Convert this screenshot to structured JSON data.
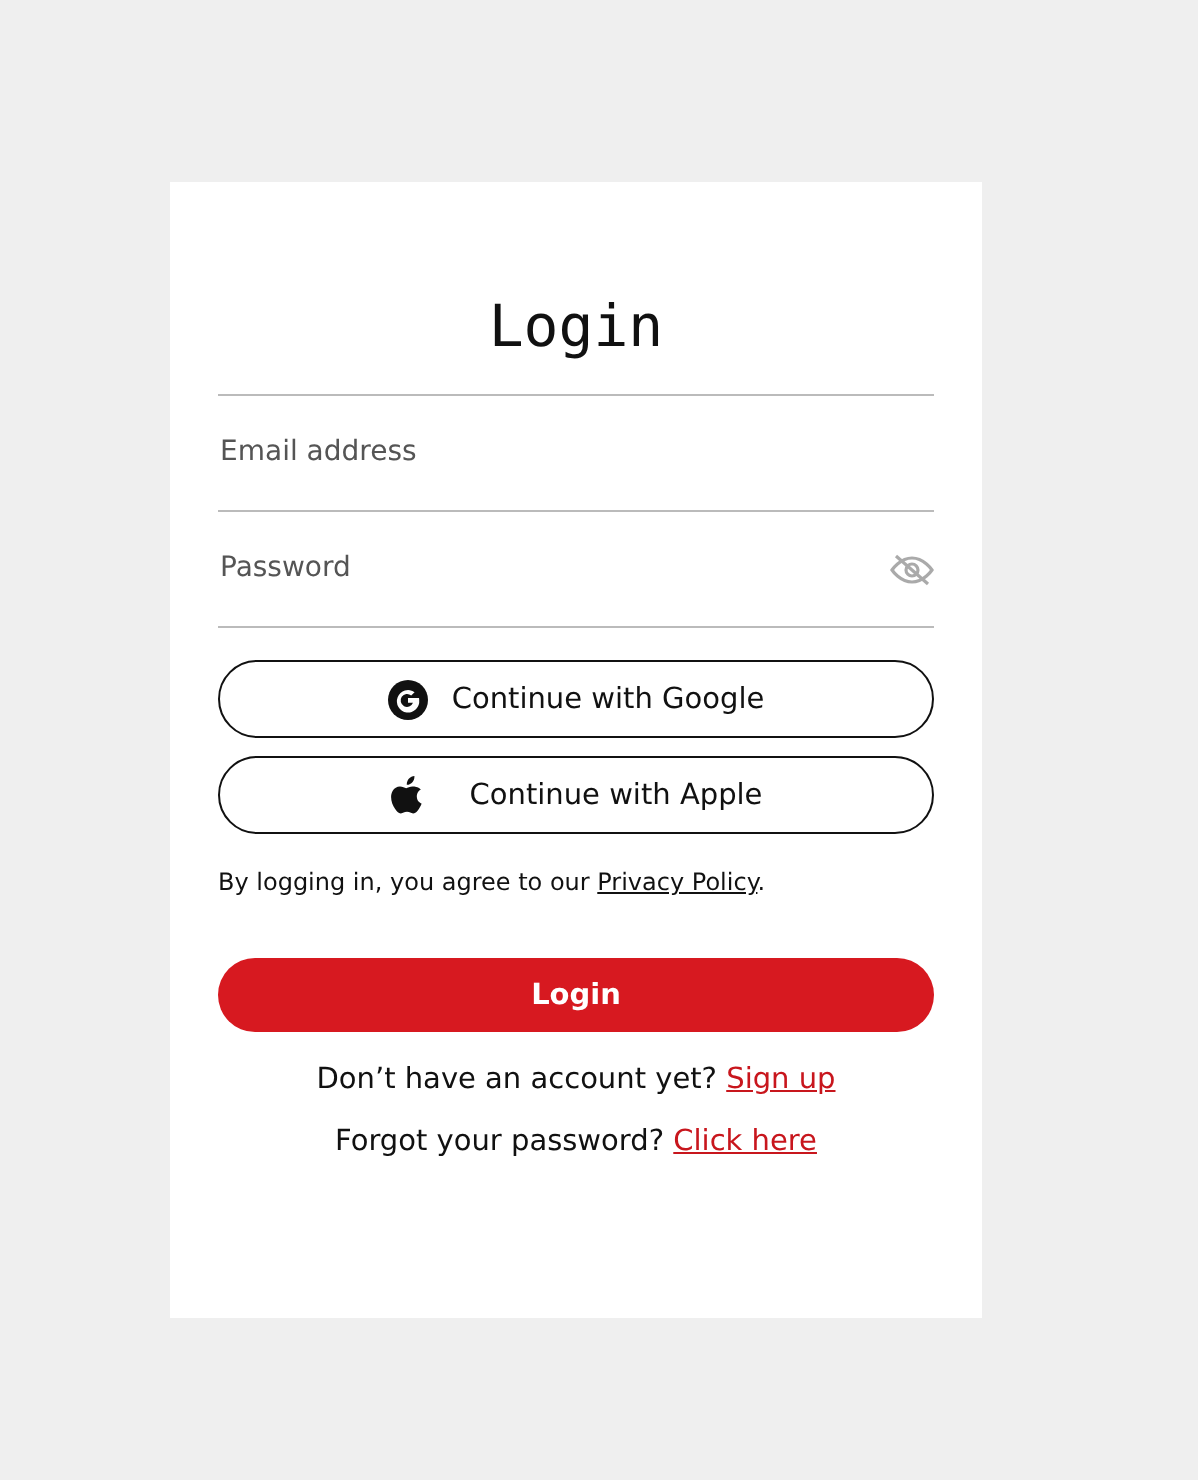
{
  "title": "Login",
  "fields": [
    {
      "kind": "email",
      "placeholder": "Email address"
    },
    {
      "kind": "password",
      "placeholder": "Password"
    }
  ],
  "social_buttons": [
    {
      "kind": "google",
      "label": "Continue with Google"
    },
    {
      "kind": "apple",
      "label": "Continue with Apple"
    }
  ],
  "consent": {
    "text": "By logging in, you agree to our ",
    "link": "Privacy Policy",
    "after": "."
  },
  "submit": "Login",
  "prompts": [
    {
      "text": "Don’t have an account yet? ",
      "link": "Sign up"
    },
    {
      "text": "Forgot your password? ",
      "link": "Click here"
    }
  ]
}
